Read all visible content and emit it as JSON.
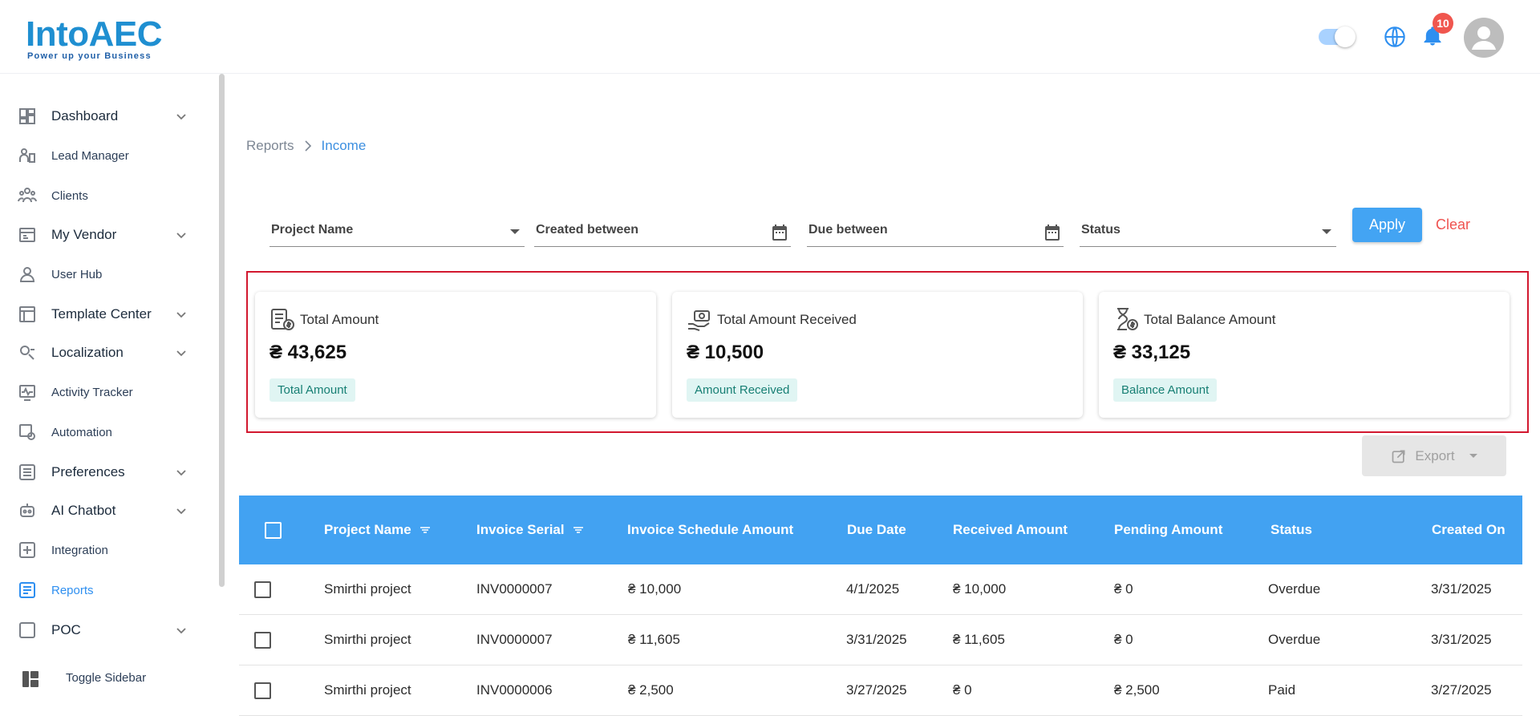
{
  "brand": {
    "name": "IntoAEC",
    "tagline": "Power up your Business"
  },
  "header": {
    "notification_count": "10"
  },
  "sidebar": {
    "items": [
      {
        "label": "Dashboard",
        "icon": "dashboard-icon",
        "has_chevron": true
      },
      {
        "label": "Lead Manager",
        "icon": "lead-manager-icon",
        "has_chevron": false
      },
      {
        "label": "Clients",
        "icon": "clients-icon",
        "has_chevron": false
      },
      {
        "label": "My Vendor",
        "icon": "vendor-icon",
        "has_chevron": true
      },
      {
        "label": "User Hub",
        "icon": "user-icon",
        "has_chevron": false
      },
      {
        "label": "Template Center",
        "icon": "template-icon",
        "has_chevron": true
      },
      {
        "label": "Localization",
        "icon": "localization-icon",
        "has_chevron": true
      },
      {
        "label": "Activity Tracker",
        "icon": "activity-icon",
        "has_chevron": false
      },
      {
        "label": "Automation",
        "icon": "automation-icon",
        "has_chevron": false
      },
      {
        "label": "Preferences",
        "icon": "preferences-icon",
        "has_chevron": true
      },
      {
        "label": "AI Chatbot",
        "icon": "chatbot-icon",
        "has_chevron": true
      },
      {
        "label": "Integration",
        "icon": "integration-icon",
        "has_chevron": false
      },
      {
        "label": "Reports",
        "icon": "reports-icon",
        "has_chevron": false,
        "active": true
      },
      {
        "label": "POC",
        "icon": "poc-icon",
        "has_chevron": true
      }
    ],
    "toggle_label": "Toggle Sidebar"
  },
  "breadcrumb": {
    "parent": "Reports",
    "current": "Income"
  },
  "filters": {
    "project_name": "Project Name",
    "created_between": "Created between",
    "due_between": "Due between",
    "status": "Status",
    "apply": "Apply",
    "clear": "Clear"
  },
  "cards": [
    {
      "title": "Total Amount",
      "value": "₴ 43,625",
      "chip": "Total Amount"
    },
    {
      "title": "Total Amount Received",
      "value": "₴ 10,500",
      "chip": "Amount Received"
    },
    {
      "title": "Total Balance Amount",
      "value": "₴ 33,125",
      "chip": "Balance Amount"
    }
  ],
  "export": {
    "label": "Export"
  },
  "table": {
    "columns": [
      "Project Name",
      "Invoice Serial",
      "Invoice Schedule Amount",
      "Due Date",
      "Received Amount",
      "Pending Amount",
      "Status",
      "Created On"
    ],
    "rows": [
      [
        "Smirthi project",
        "INV0000007",
        "₴ 10,000",
        "4/1/2025",
        "₴ 10,000",
        "₴ 0",
        "Overdue",
        "3/31/2025"
      ],
      [
        "Smirthi project",
        "INV0000007",
        "₴ 11,605",
        "3/31/2025",
        "₴ 11,605",
        "₴ 0",
        "Overdue",
        "3/31/2025"
      ],
      [
        "Smirthi project",
        "INV0000006",
        "₴ 2,500",
        "3/27/2025",
        "₴ 0",
        "₴ 2,500",
        "Paid",
        "3/27/2025"
      ]
    ]
  },
  "colors": {
    "primary": "#42a2f2",
    "highlight_border": "#d2182f",
    "chip_bg": "#e0f5f3",
    "chip_text": "#177f74",
    "clear_text": "#ef5350"
  }
}
